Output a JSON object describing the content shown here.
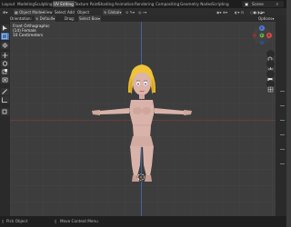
{
  "workspaces": [
    "Layout",
    "Modeling",
    "Sculpting",
    "UV Editing",
    "Texture Paint",
    "Shading",
    "Animation",
    "Rendering",
    "Compositing",
    "Geometry Nodes",
    "Scripting"
  ],
  "active_workspace": "UV Editing",
  "scene_label": "Scene",
  "header": {
    "mode": "Object Mode",
    "menus": [
      "View",
      "Select",
      "Add",
      "Object"
    ],
    "transform": "Global",
    "orientation_label": "Orientation:",
    "orientation_value": "Default",
    "drag_label": "Drag:",
    "drag_value": "Select Box",
    "options": "Options"
  },
  "viewport": {
    "line1": "Front Orthographic",
    "line2": "(14) Female",
    "line3": "10 Centimeters"
  },
  "gizmo": {
    "z": "Z",
    "x": "X",
    "y": "Y"
  },
  "status": {
    "left": "Pick Object",
    "middle": "Move Context Menu"
  },
  "colors": {
    "accent": "#4772b3",
    "hair": "#f0c43a",
    "skin": "#d9b3aa"
  }
}
